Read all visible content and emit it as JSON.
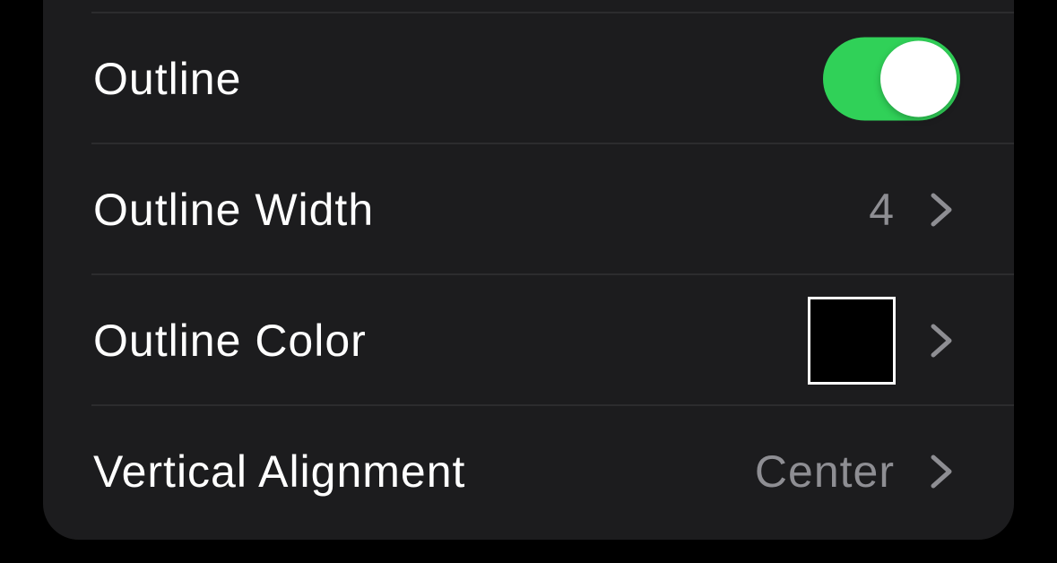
{
  "settings": {
    "outline": {
      "label": "Outline",
      "enabled": true,
      "toggle_color": "#30d158"
    },
    "outline_width": {
      "label": "Outline Width",
      "value": "4"
    },
    "outline_color": {
      "label": "Outline Color",
      "swatch_color": "#000000"
    },
    "vertical_alignment": {
      "label": "Vertical Alignment",
      "value": "Center"
    }
  },
  "icons": {
    "disclosure": "chevron-right-icon"
  }
}
